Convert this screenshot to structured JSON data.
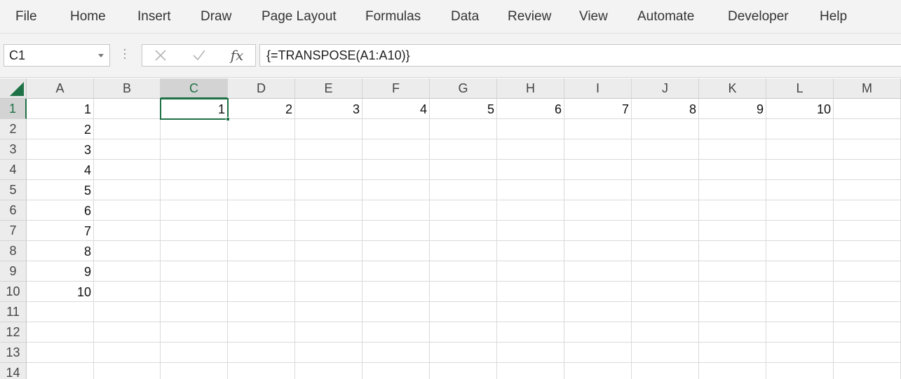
{
  "ribbon": {
    "tabs": [
      "File",
      "Home",
      "Insert",
      "Draw",
      "Page Layout",
      "Formulas",
      "Data",
      "Review",
      "View",
      "Automate",
      "Developer",
      "Help"
    ]
  },
  "formula_bar": {
    "name_box": "C1",
    "cancel_icon": "close-icon",
    "enter_icon": "check-icon",
    "fx_label": "fx",
    "formula": "{=TRANSPOSE(A1:A10)}"
  },
  "sheet": {
    "columns": [
      "A",
      "B",
      "C",
      "D",
      "E",
      "F",
      "G",
      "H",
      "I",
      "J",
      "K",
      "L",
      "M"
    ],
    "rows": [
      "1",
      "2",
      "3",
      "4",
      "5",
      "6",
      "7",
      "8",
      "9",
      "10",
      "11",
      "12",
      "13",
      "14"
    ],
    "selected_cell": "C1",
    "selected_column": "C",
    "selected_row": "1",
    "cells": [
      {
        "ref": "A1",
        "value": "1"
      },
      {
        "ref": "A2",
        "value": "2"
      },
      {
        "ref": "A3",
        "value": "3"
      },
      {
        "ref": "A4",
        "value": "4"
      },
      {
        "ref": "A5",
        "value": "5"
      },
      {
        "ref": "A6",
        "value": "6"
      },
      {
        "ref": "A7",
        "value": "7"
      },
      {
        "ref": "A8",
        "value": "8"
      },
      {
        "ref": "A9",
        "value": "9"
      },
      {
        "ref": "A10",
        "value": "10"
      },
      {
        "ref": "C1",
        "value": "1"
      },
      {
        "ref": "D1",
        "value": "2"
      },
      {
        "ref": "E1",
        "value": "3"
      },
      {
        "ref": "F1",
        "value": "4"
      },
      {
        "ref": "G1",
        "value": "5"
      },
      {
        "ref": "H1",
        "value": "6"
      },
      {
        "ref": "I1",
        "value": "7"
      },
      {
        "ref": "J1",
        "value": "8"
      },
      {
        "ref": "K1",
        "value": "9"
      },
      {
        "ref": "L1",
        "value": "10"
      }
    ]
  },
  "colors": {
    "accent": "#1e7145",
    "ribbon_bg": "#f3f3f3",
    "header_bg": "#ececec",
    "gridline": "#dadada"
  }
}
